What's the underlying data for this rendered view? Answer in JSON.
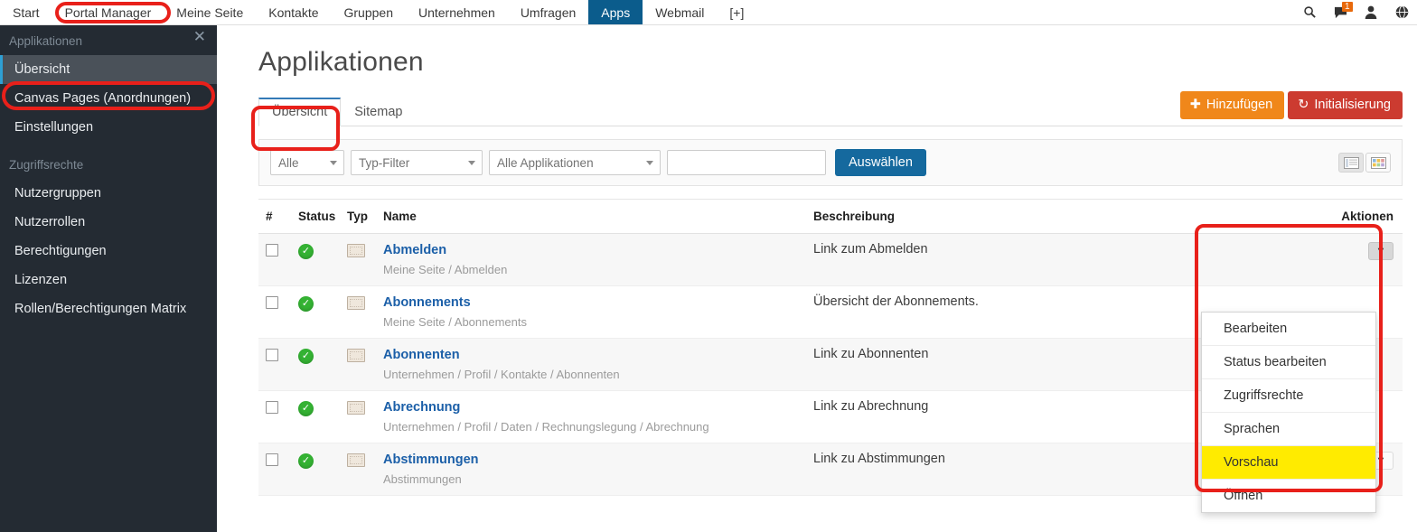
{
  "topnav": {
    "items": [
      {
        "label": "Start",
        "active": false
      },
      {
        "label": "Portal Manager",
        "active": false
      },
      {
        "label": "Meine Seite",
        "active": false
      },
      {
        "label": "Kontakte",
        "active": false
      },
      {
        "label": "Gruppen",
        "active": false
      },
      {
        "label": "Unternehmen",
        "active": false
      },
      {
        "label": "Umfragen",
        "active": false
      },
      {
        "label": "Apps",
        "active": true
      },
      {
        "label": "Webmail",
        "active": false
      },
      {
        "label": "[+]",
        "active": false
      }
    ],
    "icons": [
      "search-icon",
      "messages-icon",
      "user-icon",
      "globe-icon"
    ],
    "message_badge": "1",
    "active_bg": "#0b5c8c",
    "badge_bg": "#e8690b"
  },
  "sidebar": {
    "close_label": "✕",
    "groups": [
      {
        "title": "Applikationen",
        "items": [
          {
            "label": "Übersicht",
            "active": true
          },
          {
            "label": "Canvas Pages (Anordnungen)",
            "active": false
          },
          {
            "label": "Einstellungen",
            "active": false
          }
        ]
      },
      {
        "title": "Zugriffsrechte",
        "items": [
          {
            "label": "Nutzergruppen",
            "active": false
          },
          {
            "label": "Nutzerrollen",
            "active": false
          },
          {
            "label": "Berechtigungen",
            "active": false
          },
          {
            "label": "Lizenzen",
            "active": false
          },
          {
            "label": "Rollen/Berechtigungen Matrix",
            "active": false
          }
        ]
      }
    ],
    "bg": "#242b33",
    "active_bg": "#4a5159",
    "accent": "#2e9fd4"
  },
  "main": {
    "title": "Applikationen",
    "tabs": [
      {
        "label": "Übersicht",
        "active": true
      },
      {
        "label": "Sitemap",
        "active": false
      }
    ],
    "buttons": {
      "add": {
        "label": "Hinzufügen",
        "icon": "plus-icon",
        "color": "#f0871a"
      },
      "init": {
        "label": "Initialisierung",
        "icon": "refresh-icon",
        "color": "#cc3b30"
      }
    }
  },
  "filterbar": {
    "selects": [
      {
        "value": "Alle",
        "width": 82
      },
      {
        "value": "Typ-Filter",
        "width": 146
      },
      {
        "value": "Alle Applikationen",
        "width": 190
      }
    ],
    "search_value": "",
    "search_placeholder": "",
    "submit_label": "Auswählen",
    "submit_color": "#15699e",
    "views": [
      {
        "name": "list-view",
        "active": true
      },
      {
        "name": "tile-view",
        "active": false
      }
    ]
  },
  "table": {
    "columns": [
      "#",
      "Status",
      "Typ",
      "Name",
      "Beschreibung",
      "Aktionen"
    ],
    "rows": [
      {
        "checked": false,
        "status": "ok",
        "typ": "page-icon",
        "name": "Abmelden",
        "path": "Meine Seite / Abmelden",
        "description": "Link zum Abmelden"
      },
      {
        "checked": false,
        "status": "ok",
        "typ": "page-icon",
        "name": "Abonnements",
        "path": "Meine Seite / Abonnements",
        "description": "Übersicht der Abonnements."
      },
      {
        "checked": false,
        "status": "ok",
        "typ": "page-icon",
        "name": "Abonnenten",
        "path": "Unternehmen / Profil / Kontakte / Abonnenten",
        "description": "Link zu Abonnenten"
      },
      {
        "checked": false,
        "status": "ok",
        "typ": "page-icon",
        "name": "Abrechnung",
        "path": "Unternehmen / Profil / Daten / Rechnungslegung / Abrechnung",
        "description": "Link zu Abrechnung"
      },
      {
        "checked": false,
        "status": "ok",
        "typ": "page-icon",
        "name": "Abstimmungen",
        "path": "Abstimmungen",
        "description": "Link zu Abstimmungen"
      }
    ]
  },
  "actions_menu": {
    "items": [
      {
        "label": "Bearbeiten",
        "highlighted": false
      },
      {
        "label": "Status bearbeiten",
        "highlighted": false
      },
      {
        "label": "Zugriffsrechte",
        "highlighted": false
      },
      {
        "label": "Sprachen",
        "highlighted": false
      },
      {
        "label": "Vorschau",
        "highlighted": true
      },
      {
        "label": "Öffnen",
        "highlighted": false
      }
    ],
    "highlight_color": "#ffeb00"
  },
  "annotations": {
    "color": "#e8201a",
    "rings": [
      "portal-manager-nav",
      "sidebar-uebersicht",
      "tab-uebersicht",
      "actions-column"
    ]
  }
}
